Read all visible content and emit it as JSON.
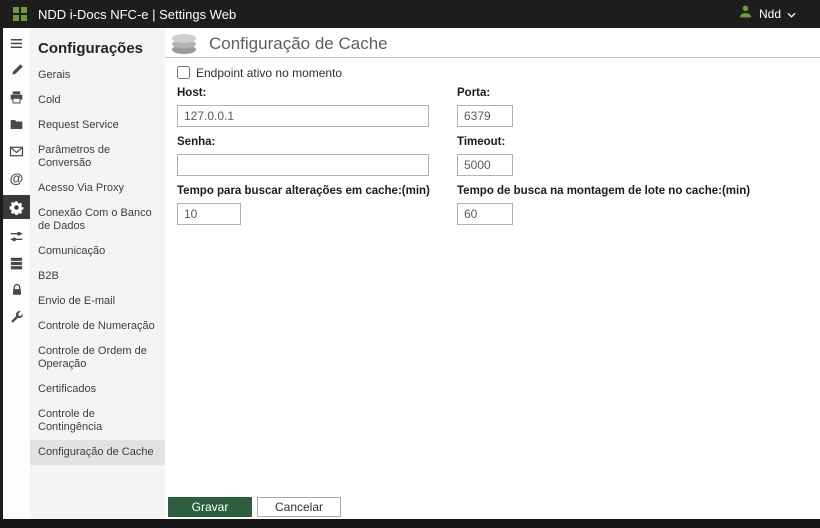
{
  "topbar": {
    "title": "NDD i-Docs NFC-e | Settings Web",
    "user_label": "Ndd"
  },
  "rail": {
    "icons": [
      "menu-icon",
      "brush-icon",
      "printer-icon",
      "folder-icon",
      "mail-icon",
      "at-icon",
      "gear-icon",
      "sliders-icon",
      "servers-icon",
      "lock-icon",
      "wrench-icon"
    ],
    "selected": "gear-icon"
  },
  "sidebar": {
    "title": "Configurações",
    "items": [
      {
        "label": "Gerais",
        "selected": false
      },
      {
        "label": "Cold",
        "selected": false
      },
      {
        "label": "Request Service",
        "selected": false
      },
      {
        "label": "Parâmetros de Conversão",
        "selected": false
      },
      {
        "label": "Acesso Via Proxy",
        "selected": false
      },
      {
        "label": "Conexão Com o Banco de Dados",
        "selected": false
      },
      {
        "label": "Comunicação",
        "selected": false
      },
      {
        "label": "B2B",
        "selected": false
      },
      {
        "label": "Envio de E-mail",
        "selected": false
      },
      {
        "label": "Controle de Numeração",
        "selected": false
      },
      {
        "label": "Controle de Ordem de Operação",
        "selected": false
      },
      {
        "label": "Certificados",
        "selected": false
      },
      {
        "label": "Controle de Contingência",
        "selected": false
      },
      {
        "label": "Configuração de Cache",
        "selected": true
      }
    ]
  },
  "main": {
    "title": "Configuração de Cache",
    "endpoint_checkbox": {
      "label": "Endpoint ativo no momento",
      "checked": false
    },
    "fields": {
      "host": {
        "label": "Host:",
        "value": "127.0.0.1"
      },
      "porta": {
        "label": "Porta:",
        "value": "6379"
      },
      "senha": {
        "label": "Senha:",
        "value": ""
      },
      "timeout": {
        "label": "Timeout:",
        "value": "5000"
      },
      "tempo_alteracoes": {
        "label": "Tempo para buscar alterações em cache:(min)",
        "value": "10"
      },
      "tempo_lote": {
        "label": "Tempo de busca na montagem de lote no cache:(min)",
        "value": "60"
      }
    },
    "buttons": {
      "save": "Gravar",
      "cancel": "Cancelar"
    }
  },
  "colors": {
    "topbar-bg": "#1d1d1d",
    "accent-green": "#6c9a3c",
    "save-green": "#2d5f3e",
    "sidebar-bg": "#f4f4f4",
    "selected-item-bg": "#e2e2e2",
    "rail-selected-bg": "#3a3a3a"
  }
}
